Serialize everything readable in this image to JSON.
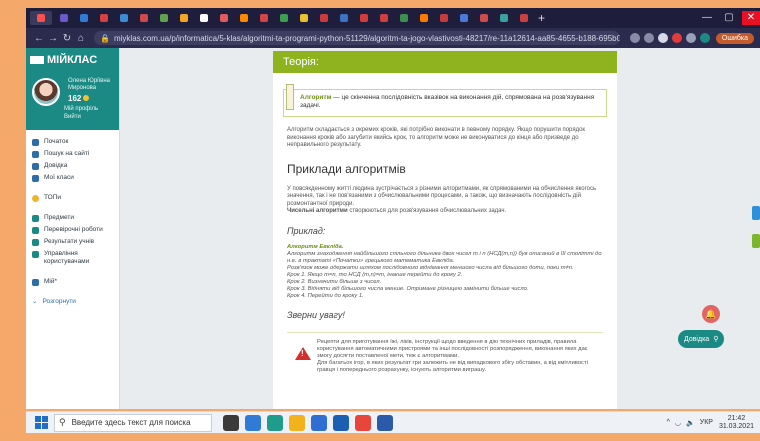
{
  "browser": {
    "tabs": [
      "",
      "",
      "",
      "",
      "",
      "",
      "",
      "",
      "",
      "",
      "",
      "",
      "",
      "",
      "",
      "",
      "",
      "",
      "",
      "",
      "",
      "",
      "",
      "",
      ""
    ],
    "tab_colors": [
      "#ff4f4f",
      "#6a5acd",
      "#2f7bd6",
      "#d94040",
      "#3b8bd6",
      "#d14a4a",
      "#5fa34a",
      "#f2a623",
      "#ffffff",
      "#e35b5b",
      "#ff8a00",
      "#d64545",
      "#3aa04d",
      "#e8c12e",
      "#ce3b3b",
      "#3b73c7",
      "#d53b3b",
      "#d23d3d",
      "#3d8f4f",
      "#ff7a00",
      "#c73b3b",
      "#4b7bd8",
      "#d14a4a",
      "#3aa0a0",
      "#cc4040"
    ],
    "new_tab": "+",
    "window_controls": [
      "—",
      "▢",
      "✕"
    ],
    "url": "miyklas.com.ua/p/informatica/5-klas/algoritmi-ta-programi-python-51129/algoritm-ta-jogo-vlastivosti-48217/re-11a12614-aa85-4655-b188-695b028496ad",
    "error_badge": "Ошибка"
  },
  "sidebar": {
    "brand": "МІЙКЛАС",
    "profile": {
      "name": "Олена Юріївна Миронова",
      "points": "162",
      "link_profile": "Мій профіль",
      "link_logout": "Вийти"
    },
    "menu": [
      {
        "label": "Початок",
        "icon": "home-icon"
      },
      {
        "label": "Пошук на сайті",
        "icon": "search-icon"
      },
      {
        "label": "Довідка",
        "icon": "help-icon"
      },
      {
        "label": "Мої класи",
        "icon": "classes-icon"
      }
    ],
    "menu_top": {
      "label": "ТОПи",
      "icon": "star-icon"
    },
    "menu_teacher": [
      {
        "label": "Предмети",
        "icon": "subjects-icon"
      },
      {
        "label": "Перевірочні роботи",
        "icon": "tests-icon"
      },
      {
        "label": "Результати учнів",
        "icon": "results-icon"
      },
      {
        "label": "Управління користувачами",
        "icon": "users-icon"
      }
    ],
    "menu_mii": {
      "label": "Мій*",
      "icon": "mii-icon"
    },
    "expand": "Розгорнути"
  },
  "content": {
    "section": "Теорія:",
    "definition_term": "Алгоритм",
    "definition_rest": " — це скінченна послідовність вказівок на виконання дій, спрямована на розв'язування задачі.",
    "p1": "Алгоритм складається з окремих кроків, які потрібно виконати в певному порядку. Якщо порушити порядок виконання кроків або загубити якийсь крок, то алгоритм може не виконуватися до кінця або призведе до неправильного результату.",
    "h_examples": "Приклади алгоритмів",
    "p2": "У повсякденному житті людина зустрічається з різними алгоритмами, як спрямованими на обчислення якогось значення, так і не пов'язаними з обчислювальними процесами, а також, що визначають послідовність дій розмонтантної природи.",
    "p3_bold": "Чисельні алгоритми",
    "p3_rest": " створюються для розв'язування обчислювальних задач.",
    "h_example": "Приклад:",
    "ex_title": "Алгоритм Евкліда.",
    "ex_lines": [
      "Алгоритм знаходження найбільшого спільного дільника двох чисел m і n (НСД(m,n)) був описаний в III столітті до н.е. в трактаті «Початки» грецького математика Евкліда.",
      "Розв'язок може одержати шляхом послідовного віднімання меншого числа від більшого доти, поки m≠n.",
      "Крок 1. Якщо m=n, то НСД (m,n)=m, інакше перейти до кроку 2.",
      "Крок 2. Визначити більше з чисел.",
      "Крок 3. Відняти від більшого числа менше. Отримане різницею замінити більше число.",
      "Крок 4. Перейти до кроку 1."
    ],
    "h_attention": "Зверни увагу!",
    "note1": "Рецепти для приготування їжі, ліків, інструкції щодо введення в дію технічних приладів, правила користування автоматичними пристроями та інші послідовності розпорядження, виконання яких дає змогу досягти поставленої мети, теж є алгоритмами.",
    "note2": "Для багатьох ігор, в яких результат гри залежить не від випадкового збігу обставин, а від кмітливості гравця і попереднього розрахунку, існують алгоритми виграшу."
  },
  "help_button": "Довідка",
  "taskbar": {
    "search_placeholder": "Введите здесь текст для поиска",
    "app_colors": [
      "#3a3a3a",
      "#2f7bd6",
      "#1f9c8c",
      "#f1b21c",
      "#2f6fd1",
      "#1b5fb3",
      "#e8463a",
      "#2b5aa8"
    ],
    "lang": "УКР",
    "time": "21:42",
    "date": "31.03.2021"
  }
}
